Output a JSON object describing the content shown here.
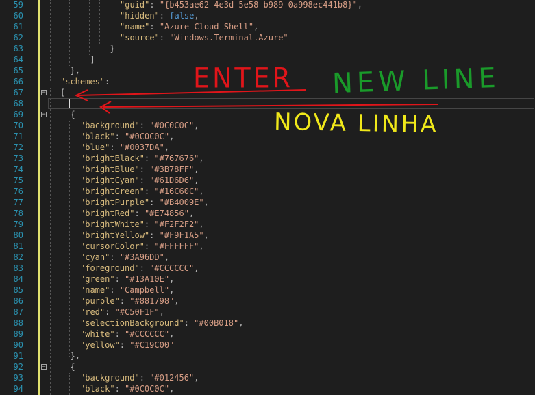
{
  "editor": {
    "lines": [
      {
        "n": "59",
        "indent": 6,
        "parts": [
          [
            "k",
            "\"guid\""
          ],
          [
            "p",
            ": "
          ],
          [
            "s",
            "\"{b453ae62-4e3d-5e58-b989-0a998ec441b8}\""
          ],
          [
            "p",
            ","
          ]
        ]
      },
      {
        "n": "60",
        "indent": 6,
        "parts": [
          [
            "k",
            "\"hidden\""
          ],
          [
            "p",
            ": "
          ],
          [
            "b",
            "false"
          ],
          [
            "p",
            ","
          ]
        ]
      },
      {
        "n": "61",
        "indent": 6,
        "parts": [
          [
            "k",
            "\"name\""
          ],
          [
            "p",
            ": "
          ],
          [
            "s",
            "\"Azure Cloud Shell\""
          ],
          [
            "p",
            ","
          ]
        ]
      },
      {
        "n": "62",
        "indent": 6,
        "parts": [
          [
            "k",
            "\"source\""
          ],
          [
            "p",
            ": "
          ],
          [
            "s",
            "\"Windows.Terminal.Azure\""
          ]
        ]
      },
      {
        "n": "63",
        "indent": 5,
        "parts": [
          [
            "p",
            "}"
          ]
        ]
      },
      {
        "n": "64",
        "indent": 3,
        "parts": [
          [
            "p",
            "]"
          ]
        ]
      },
      {
        "n": "65",
        "indent": 1,
        "parts": [
          [
            "p",
            "},"
          ]
        ]
      },
      {
        "n": "66",
        "indent": 0,
        "parts": [
          [
            "k",
            "\"schemes\""
          ],
          [
            "p",
            ":"
          ]
        ]
      },
      {
        "n": "67",
        "indent": 0,
        "parts": [
          [
            "p",
            "["
          ]
        ]
      },
      {
        "n": "68",
        "indent": 0,
        "parts": []
      },
      {
        "n": "69",
        "indent": 1,
        "parts": [
          [
            "p",
            "{"
          ]
        ]
      },
      {
        "n": "70",
        "indent": 2,
        "parts": [
          [
            "k",
            "\"background\""
          ],
          [
            "p",
            ": "
          ],
          [
            "s",
            "\"#0C0C0C\""
          ],
          [
            "p",
            ","
          ]
        ]
      },
      {
        "n": "71",
        "indent": 2,
        "parts": [
          [
            "k",
            "\"black\""
          ],
          [
            "p",
            ": "
          ],
          [
            "s",
            "\"#0C0C0C\""
          ],
          [
            "p",
            ","
          ]
        ]
      },
      {
        "n": "72",
        "indent": 2,
        "parts": [
          [
            "k",
            "\"blue\""
          ],
          [
            "p",
            ": "
          ],
          [
            "s",
            "\"#0037DA\""
          ],
          [
            "p",
            ","
          ]
        ]
      },
      {
        "n": "73",
        "indent": 2,
        "parts": [
          [
            "k",
            "\"brightBlack\""
          ],
          [
            "p",
            ": "
          ],
          [
            "s",
            "\"#767676\""
          ],
          [
            "p",
            ","
          ]
        ]
      },
      {
        "n": "74",
        "indent": 2,
        "parts": [
          [
            "k",
            "\"brightBlue\""
          ],
          [
            "p",
            ": "
          ],
          [
            "s",
            "\"#3B78FF\""
          ],
          [
            "p",
            ","
          ]
        ]
      },
      {
        "n": "75",
        "indent": 2,
        "parts": [
          [
            "k",
            "\"brightCyan\""
          ],
          [
            "p",
            ": "
          ],
          [
            "s",
            "\"#61D6D6\""
          ],
          [
            "p",
            ","
          ]
        ]
      },
      {
        "n": "76",
        "indent": 2,
        "parts": [
          [
            "k",
            "\"brightGreen\""
          ],
          [
            "p",
            ": "
          ],
          [
            "s",
            "\"#16C60C\""
          ],
          [
            "p",
            ","
          ]
        ]
      },
      {
        "n": "77",
        "indent": 2,
        "parts": [
          [
            "k",
            "\"brightPurple\""
          ],
          [
            "p",
            ": "
          ],
          [
            "s",
            "\"#B4009E\""
          ],
          [
            "p",
            ","
          ]
        ]
      },
      {
        "n": "78",
        "indent": 2,
        "parts": [
          [
            "k",
            "\"brightRed\""
          ],
          [
            "p",
            ": "
          ],
          [
            "s",
            "\"#E74856\""
          ],
          [
            "p",
            ","
          ]
        ]
      },
      {
        "n": "79",
        "indent": 2,
        "parts": [
          [
            "k",
            "\"brightWhite\""
          ],
          [
            "p",
            ": "
          ],
          [
            "s",
            "\"#F2F2F2\""
          ],
          [
            "p",
            ","
          ]
        ]
      },
      {
        "n": "80",
        "indent": 2,
        "parts": [
          [
            "k",
            "\"brightYellow\""
          ],
          [
            "p",
            ": "
          ],
          [
            "s",
            "\"#F9F1A5\""
          ],
          [
            "p",
            ","
          ]
        ]
      },
      {
        "n": "81",
        "indent": 2,
        "parts": [
          [
            "k",
            "\"cursorColor\""
          ],
          [
            "p",
            ": "
          ],
          [
            "s",
            "\"#FFFFFF\""
          ],
          [
            "p",
            ","
          ]
        ]
      },
      {
        "n": "82",
        "indent": 2,
        "parts": [
          [
            "k",
            "\"cyan\""
          ],
          [
            "p",
            ": "
          ],
          [
            "s",
            "\"#3A96DD\""
          ],
          [
            "p",
            ","
          ]
        ]
      },
      {
        "n": "83",
        "indent": 2,
        "parts": [
          [
            "k",
            "\"foreground\""
          ],
          [
            "p",
            ": "
          ],
          [
            "s",
            "\"#CCCCCC\""
          ],
          [
            "p",
            ","
          ]
        ]
      },
      {
        "n": "84",
        "indent": 2,
        "parts": [
          [
            "k",
            "\"green\""
          ],
          [
            "p",
            ": "
          ],
          [
            "s",
            "\"#13A10E\""
          ],
          [
            "p",
            ","
          ]
        ]
      },
      {
        "n": "85",
        "indent": 2,
        "parts": [
          [
            "k",
            "\"name\""
          ],
          [
            "p",
            ": "
          ],
          [
            "s",
            "\"Campbell\""
          ],
          [
            "p",
            ","
          ]
        ]
      },
      {
        "n": "86",
        "indent": 2,
        "parts": [
          [
            "k",
            "\"purple\""
          ],
          [
            "p",
            ": "
          ],
          [
            "s",
            "\"#881798\""
          ],
          [
            "p",
            ","
          ]
        ]
      },
      {
        "n": "87",
        "indent": 2,
        "parts": [
          [
            "k",
            "\"red\""
          ],
          [
            "p",
            ": "
          ],
          [
            "s",
            "\"#C50F1F\""
          ],
          [
            "p",
            ","
          ]
        ]
      },
      {
        "n": "88",
        "indent": 2,
        "parts": [
          [
            "k",
            "\"selectionBackground\""
          ],
          [
            "p",
            ": "
          ],
          [
            "s",
            "\"#00B018\""
          ],
          [
            "p",
            ","
          ]
        ]
      },
      {
        "n": "89",
        "indent": 2,
        "parts": [
          [
            "k",
            "\"white\""
          ],
          [
            "p",
            ": "
          ],
          [
            "s",
            "\"#CCCCCC\""
          ],
          [
            "p",
            ","
          ]
        ]
      },
      {
        "n": "90",
        "indent": 2,
        "parts": [
          [
            "k",
            "\"yellow\""
          ],
          [
            "p",
            ": "
          ],
          [
            "s",
            "\"#C19C00\""
          ]
        ]
      },
      {
        "n": "91",
        "indent": 1,
        "parts": [
          [
            "p",
            "},"
          ]
        ]
      },
      {
        "n": "92",
        "indent": 1,
        "parts": [
          [
            "p",
            "{"
          ]
        ]
      },
      {
        "n": "93",
        "indent": 2,
        "parts": [
          [
            "k",
            "\"background\""
          ],
          [
            "p",
            ": "
          ],
          [
            "s",
            "\"#012456\""
          ],
          [
            "p",
            ","
          ]
        ]
      },
      {
        "n": "94",
        "indent": 2,
        "parts": [
          [
            "k",
            "\"black\""
          ],
          [
            "p",
            ": "
          ],
          [
            "s",
            "\"#0C0C0C\""
          ],
          [
            "p",
            ","
          ]
        ]
      }
    ],
    "fold_markers": [
      "67",
      "69",
      "92"
    ],
    "fold_glyph": "−"
  },
  "annotations": {
    "enter": {
      "text": "ENTER",
      "color": "#e0151a"
    },
    "new_line": {
      "text": "NEW LINE",
      "color": "#1a9a2a"
    },
    "nova_linha": {
      "text": "NOVA LINHA",
      "color": "#f0e81a"
    }
  },
  "colors": {
    "background": "#1e1e1e",
    "line_number": "#2b91af",
    "property_key": "#d7ba7d",
    "string_value": "#d69d85",
    "keyword": "#569cd6",
    "change_bar": "#e2e26f"
  }
}
